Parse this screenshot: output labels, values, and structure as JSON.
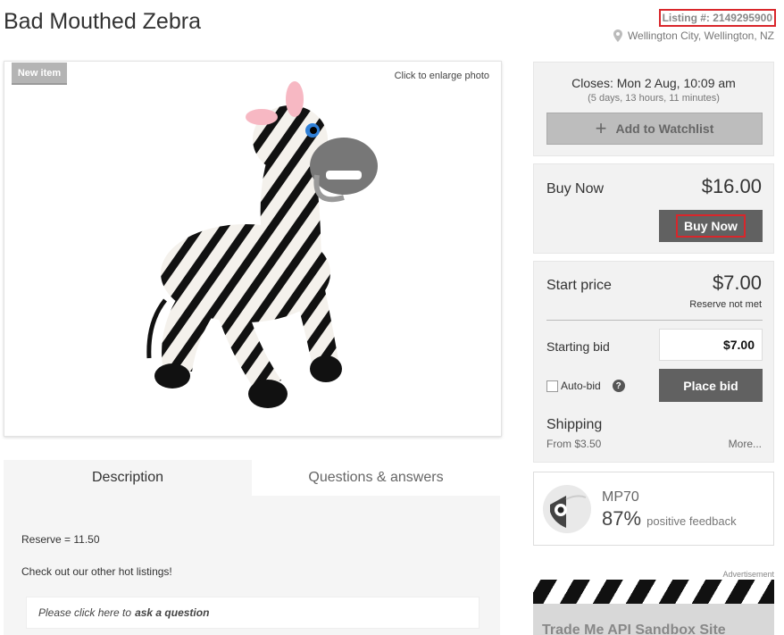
{
  "listing": {
    "title": "Bad Mouthed Zebra",
    "listing_number": "Listing #: 2149295900",
    "location": "Wellington City, Wellington, NZ"
  },
  "photo": {
    "badge": "New item",
    "enlarge_label": "Click to enlarge photo"
  },
  "tabs": [
    {
      "label": "Description"
    },
    {
      "label": "Questions & answers"
    }
  ],
  "description": {
    "lines": [
      "Reserve = 11.50",
      "Check out our other hot listings!"
    ],
    "ask_prefix": "Please click here to",
    "ask_bold": "ask a question"
  },
  "closing": {
    "closes_text": "Closes: Mon 2 Aug, 10:09 am",
    "time_left": "(5 days, 13 hours, 11 minutes)",
    "watchlist_label": "Add to Watchlist"
  },
  "buy_now": {
    "label": "Buy Now",
    "price": "$16.00",
    "button_label": "Buy Now"
  },
  "bidding": {
    "start_label": "Start price",
    "start_price": "$7.00",
    "reserve_status": "Reserve not met",
    "starting_bid_label": "Starting bid",
    "starting_bid_value": "$7.00",
    "autobid_label": "Auto-bid",
    "help_glyph": "?",
    "place_bid_label": "Place bid",
    "shipping_label": "Shipping",
    "shipping_from": "From $3.50",
    "more_label": "More..."
  },
  "seller": {
    "name": "MP70",
    "feedback_percent": "87%",
    "feedback_label": "positive feedback"
  },
  "ad": {
    "label": "Advertisement",
    "text": "Trade Me API Sandbox Site"
  },
  "colors": {
    "highlight": "#d9262b",
    "button_dark": "#616161",
    "panel_bg": "#f2f2f2"
  }
}
